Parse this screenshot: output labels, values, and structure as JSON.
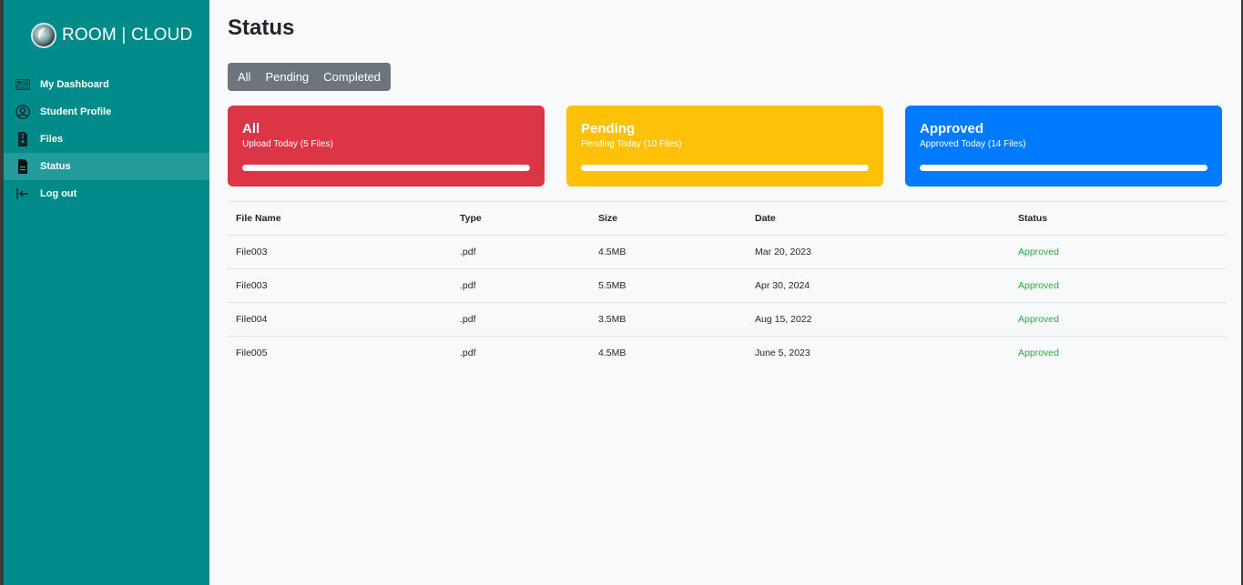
{
  "brand": {
    "name": "ROOM | CLOUD",
    "logo_icon": "globe-logo-icon"
  },
  "sidebar": {
    "items": [
      {
        "label": "My Dashboard",
        "icon": "dashboard-icon",
        "active": false
      },
      {
        "label": "Student Profile",
        "icon": "user-circle-icon",
        "active": false
      },
      {
        "label": "Files",
        "icon": "file-zipper-icon",
        "active": false
      },
      {
        "label": "Status",
        "icon": "file-icon",
        "active": true
      },
      {
        "label": "Log out",
        "icon": "logout-icon",
        "active": false
      }
    ]
  },
  "main": {
    "title": "Status",
    "filters": [
      "All",
      "Pending",
      "Completed"
    ],
    "cards": [
      {
        "title": "All",
        "subtitle": "Upload Today (5 Files)",
        "color": "#dc3545",
        "progress": 1.0
      },
      {
        "title": "Pending",
        "subtitle": "Pending Today (10 Files)",
        "color": "#ffc107",
        "progress": 1.0
      },
      {
        "title": "Approved",
        "subtitle": "Approved Today (14 Files)",
        "color": "#007bff",
        "progress": 1.0
      }
    ],
    "table": {
      "headers": [
        "File Name",
        "Type",
        "Size",
        "Date",
        "Status"
      ],
      "rows": [
        [
          "File003",
          ".pdf",
          "4.5MB",
          "Mar 20, 2023",
          "Approved"
        ],
        [
          "File003",
          ".pdf",
          "5.5MB",
          "Apr 30, 2024",
          "Approved"
        ],
        [
          "File004",
          ".pdf",
          "3.5MB",
          "Aug 15, 2022",
          "Approved"
        ],
        [
          "File005",
          ".pdf",
          "4.5MB",
          "June 5, 2023",
          "Approved"
        ]
      ]
    }
  },
  "colors": {
    "sidebar": "#008b8b",
    "approved": "#28a745",
    "filter_bg": "#6c757d"
  }
}
